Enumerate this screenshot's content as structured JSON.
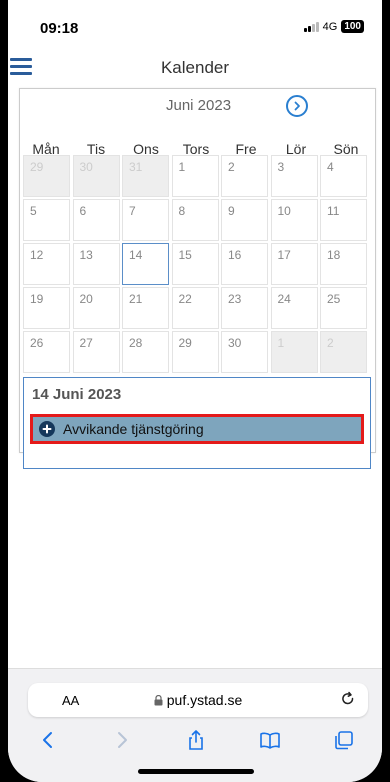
{
  "status_bar": {
    "time": "09:18",
    "network": "4G",
    "battery": "100"
  },
  "app_bar": {
    "title": "Kalender",
    "menu_icon": "hamburger-menu-icon"
  },
  "calendar": {
    "month_label": "Juni 2023",
    "next_icon": "chevron-right-circle-icon",
    "weekdays": [
      "Mån",
      "Tis",
      "Ons",
      "Tors",
      "Fre",
      "Lör",
      "Sön"
    ],
    "weeks": [
      [
        {
          "d": "29",
          "other": true
        },
        {
          "d": "30",
          "other": true
        },
        {
          "d": "31",
          "other": true
        },
        {
          "d": "1"
        },
        {
          "d": "2"
        },
        {
          "d": "3"
        },
        {
          "d": "4"
        }
      ],
      [
        {
          "d": "5"
        },
        {
          "d": "6"
        },
        {
          "d": "7"
        },
        {
          "d": "8"
        },
        {
          "d": "9"
        },
        {
          "d": "10"
        },
        {
          "d": "11"
        }
      ],
      [
        {
          "d": "12"
        },
        {
          "d": "13"
        },
        {
          "d": "14",
          "selected": true
        },
        {
          "d": "15"
        },
        {
          "d": "16"
        },
        {
          "d": "17"
        },
        {
          "d": "18"
        }
      ],
      [
        {
          "d": "19"
        },
        {
          "d": "20"
        },
        {
          "d": "21"
        },
        {
          "d": "22"
        },
        {
          "d": "23"
        },
        {
          "d": "24"
        },
        {
          "d": "25"
        }
      ],
      [
        {
          "d": "26"
        },
        {
          "d": "27"
        },
        {
          "d": "28"
        },
        {
          "d": "29"
        },
        {
          "d": "30"
        },
        {
          "d": "1",
          "other": true
        },
        {
          "d": "2",
          "other": true
        }
      ]
    ]
  },
  "day_panel": {
    "date_title": "14 Juni 2023",
    "action_label": "Avvikande tjänstgöring",
    "action_icon": "plus-circle-icon",
    "highlight_color": "#e41a1a"
  },
  "browser": {
    "text_size_label": "AA",
    "url": "puf.ystad.se",
    "accent_color": "#1a73e8"
  }
}
